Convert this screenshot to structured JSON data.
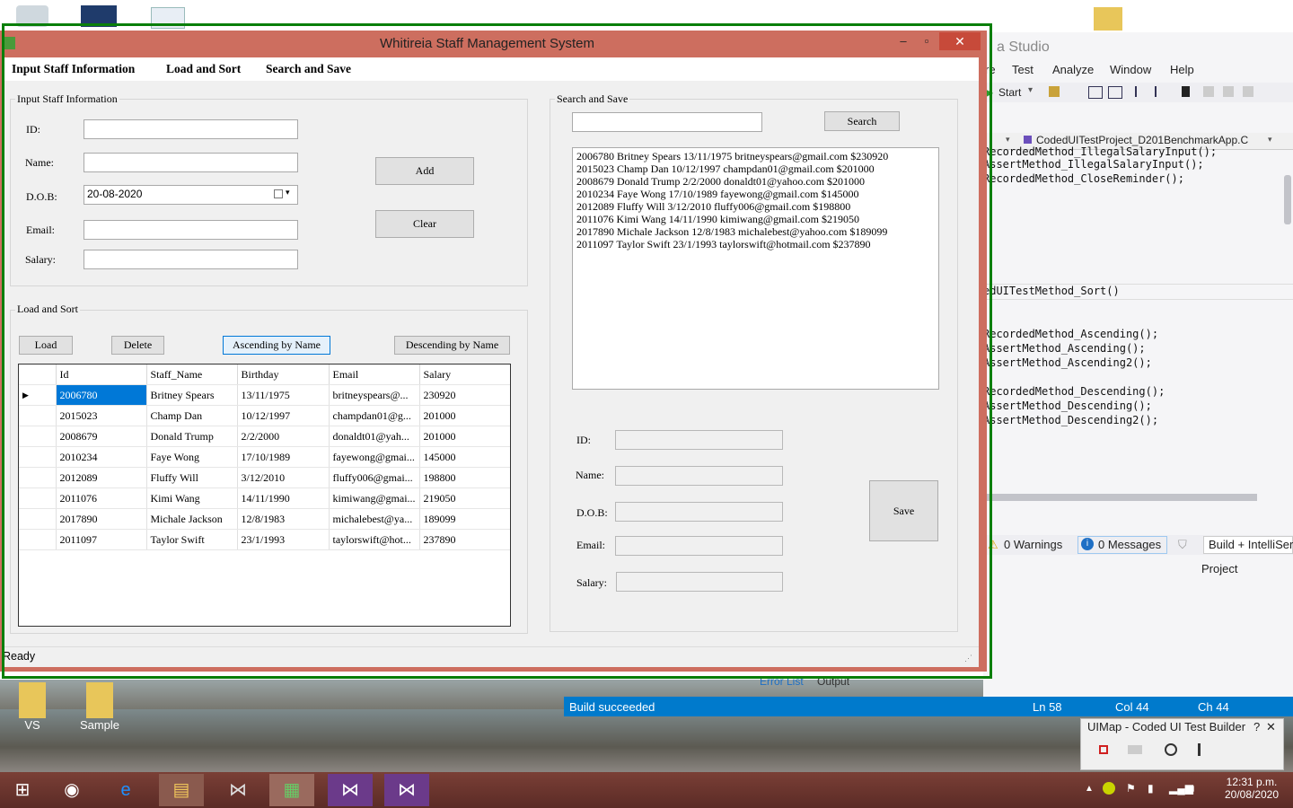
{
  "vs": {
    "title": "a Studio",
    "menu": [
      "re",
      "Test",
      "Analyze",
      "Window",
      "Help"
    ],
    "start_label": "Start",
    "combo_text": "CodedUITestProject_D201BenchmarkApp.C",
    "code_lines": [
      "RecordedMethod_IllegalSalaryInput();",
      "AssertMethod_IllegalSalaryInput();",
      "RecordedMethod_CloseReminder();",
      "edUITestMethod_Sort()",
      "RecordedMethod_Ascending();",
      "AssertMethod_Ascending();",
      "AssertMethod_Ascending2();",
      "RecordedMethod_Descending();",
      "AssertMethod_Descending();",
      "AssertMethod_Descending2();"
    ],
    "warnings": "0 Warnings",
    "messages": "0 Messages",
    "build_filter": "Build + IntelliSer",
    "project_col": "Project",
    "error_list_tab": "Error List",
    "output_tab": "Output",
    "status": {
      "build": "Build succeeded",
      "ln": "Ln 58",
      "col": "Col 44",
      "ch": "Ch 44"
    }
  },
  "uimap": {
    "title": "UIMap - Coded UI Test Builder",
    "help": "?",
    "close": "✕"
  },
  "app": {
    "title": "Whitireia Staff Management System",
    "menu": [
      "Input Staff Information",
      "Load and Sort",
      "Search and Save"
    ],
    "input_group": {
      "title": "Input Staff Information",
      "labels": {
        "id": "ID:",
        "name": "Name:",
        "dob": "D.O.B:",
        "email": "Email:",
        "salary": "Salary:"
      },
      "values": {
        "id": "",
        "name": "",
        "dob": "20-08-2020",
        "email": "",
        "salary": ""
      },
      "add": "Add",
      "clear": "Clear"
    },
    "sort_group": {
      "title": "Load and Sort",
      "load": "Load",
      "delete": "Delete",
      "ascending": "Ascending by Name",
      "descending": "Descending by Name",
      "columns": [
        "Id",
        "Staff_Name",
        "Birthday",
        "Email",
        "Salary"
      ],
      "rows": [
        [
          "2006780",
          "Britney Spears",
          "13/11/1975",
          "britneyspears@...",
          "230920"
        ],
        [
          "2015023",
          "Champ Dan",
          "10/12/1997",
          "champdan01@g...",
          "201000"
        ],
        [
          "2008679",
          "Donald Trump",
          "2/2/2000",
          "donaldt01@yah...",
          "201000"
        ],
        [
          "2010234",
          "Faye Wong",
          "17/10/1989",
          "fayewong@gmai...",
          "145000"
        ],
        [
          "2012089",
          "Fluffy Will",
          "3/12/2010",
          "fluffy006@gmai...",
          "198800"
        ],
        [
          "2011076",
          "Kimi Wang",
          "14/11/1990",
          "kimiwang@gmai...",
          "219050"
        ],
        [
          "2017890",
          "Michale Jackson",
          "12/8/1983",
          "michalebest@ya...",
          "189099"
        ],
        [
          "2011097",
          "Taylor Swift",
          "23/1/1993",
          "taylorswift@hot...",
          "237890"
        ]
      ]
    },
    "search_group": {
      "title": "Search and Save",
      "search_value": "",
      "search_button": "Search",
      "results": [
        "2006780 Britney Spears 13/11/1975 britneyspears@gmail.com $230920",
        "2015023 Champ Dan 10/12/1997 champdan01@gmail.com $201000",
        "2008679 Donald Trump 2/2/2000 donaldt01@yahoo.com $201000",
        "2010234 Faye Wong 17/10/1989 fayewong@gmail.com $145000",
        "2012089 Fluffy Will 3/12/2010 fluffy006@gmail.com $198800",
        "2011076 Kimi Wang 14/11/1990 kimiwang@gmail.com $219050",
        "2017890 Michale Jackson 12/8/1983 michalebest@yahoo.com $189099",
        "2011097 Taylor Swift 23/1/1993 taylorswift@hotmail.com $237890"
      ],
      "labels": {
        "id": "ID:",
        "name": "Name:",
        "dob": "D.O.B:",
        "email": "Email:",
        "salary": "Salary:"
      },
      "save": "Save"
    },
    "status": "Ready"
  },
  "desktop_icons": [
    "VS",
    "Sample"
  ],
  "clock": {
    "time": "12:31 p.m.",
    "date": "20/08/2020"
  }
}
